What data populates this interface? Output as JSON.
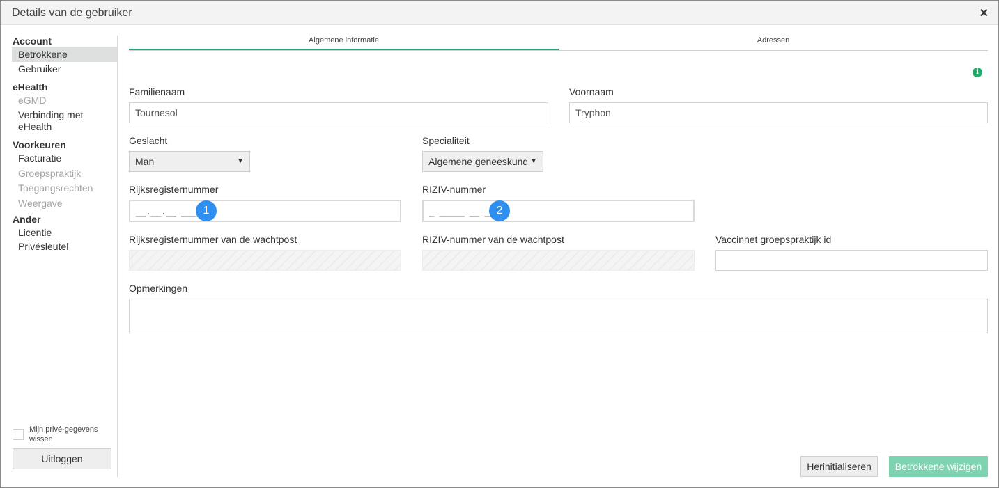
{
  "window": {
    "title": "Details van de gebruiker",
    "close_icon": "close-icon"
  },
  "sidebar": {
    "groups": [
      {
        "label": "Account",
        "items": [
          {
            "label": "Betrokkene",
            "state": "active"
          },
          {
            "label": "Gebruiker",
            "state": "enabled"
          }
        ]
      },
      {
        "label": "eHealth",
        "items": [
          {
            "label": "eGMD",
            "state": "disabled"
          },
          {
            "label": "Verbinding met eHealth",
            "state": "enabled"
          }
        ]
      },
      {
        "label": "Voorkeuren",
        "items": [
          {
            "label": "Facturatie",
            "state": "enabled"
          },
          {
            "label": "Groepspraktijk",
            "state": "disabled"
          },
          {
            "label": "Toegangsrechten",
            "state": "disabled"
          },
          {
            "label": "Weergave",
            "state": "disabled"
          }
        ]
      },
      {
        "label": "Ander",
        "items": [
          {
            "label": "Licentie",
            "state": "enabled"
          },
          {
            "label": "Privésleutel",
            "state": "enabled"
          }
        ]
      }
    ],
    "clear_private_label": "Mijn privé-gegevens wissen",
    "logout_label": "Uitloggen"
  },
  "tabs": [
    {
      "label": "Algemene informatie",
      "active": true
    },
    {
      "label": "Adressen",
      "active": false
    }
  ],
  "info_icon": "info-icon",
  "form": {
    "familienaam": {
      "label": "Familienaam",
      "value": "Tournesol"
    },
    "voornaam": {
      "label": "Voornaam",
      "value": "Tryphon"
    },
    "geslacht": {
      "label": "Geslacht",
      "value": "Man"
    },
    "specialiteit": {
      "label": "Specialiteit",
      "value": "Algemene geneeskunde"
    },
    "rijksregisternummer": {
      "label": "Rijksregisternummer",
      "mask": "__.__.__-___.__",
      "badge": "1"
    },
    "riziv": {
      "label": "RIZIV-nummer",
      "mask": "_-_____-__-___",
      "badge": "2"
    },
    "rijks_wachtpost": {
      "label": "Rijksregisternummer van de wachtpost"
    },
    "riziv_wachtpost": {
      "label": "RIZIV-nummer van de wachtpost"
    },
    "vaccinnet": {
      "label": "Vaccinnet groepspraktijk id",
      "value": ""
    },
    "opmerkingen": {
      "label": "Opmerkingen",
      "value": ""
    }
  },
  "buttons": {
    "reset": "Herinitialiseren",
    "save": "Betrokkene wijzigen"
  },
  "colors": {
    "accent": "#24a67a",
    "save_button": "#7ed3b0",
    "badge": "#2f8ff0"
  }
}
